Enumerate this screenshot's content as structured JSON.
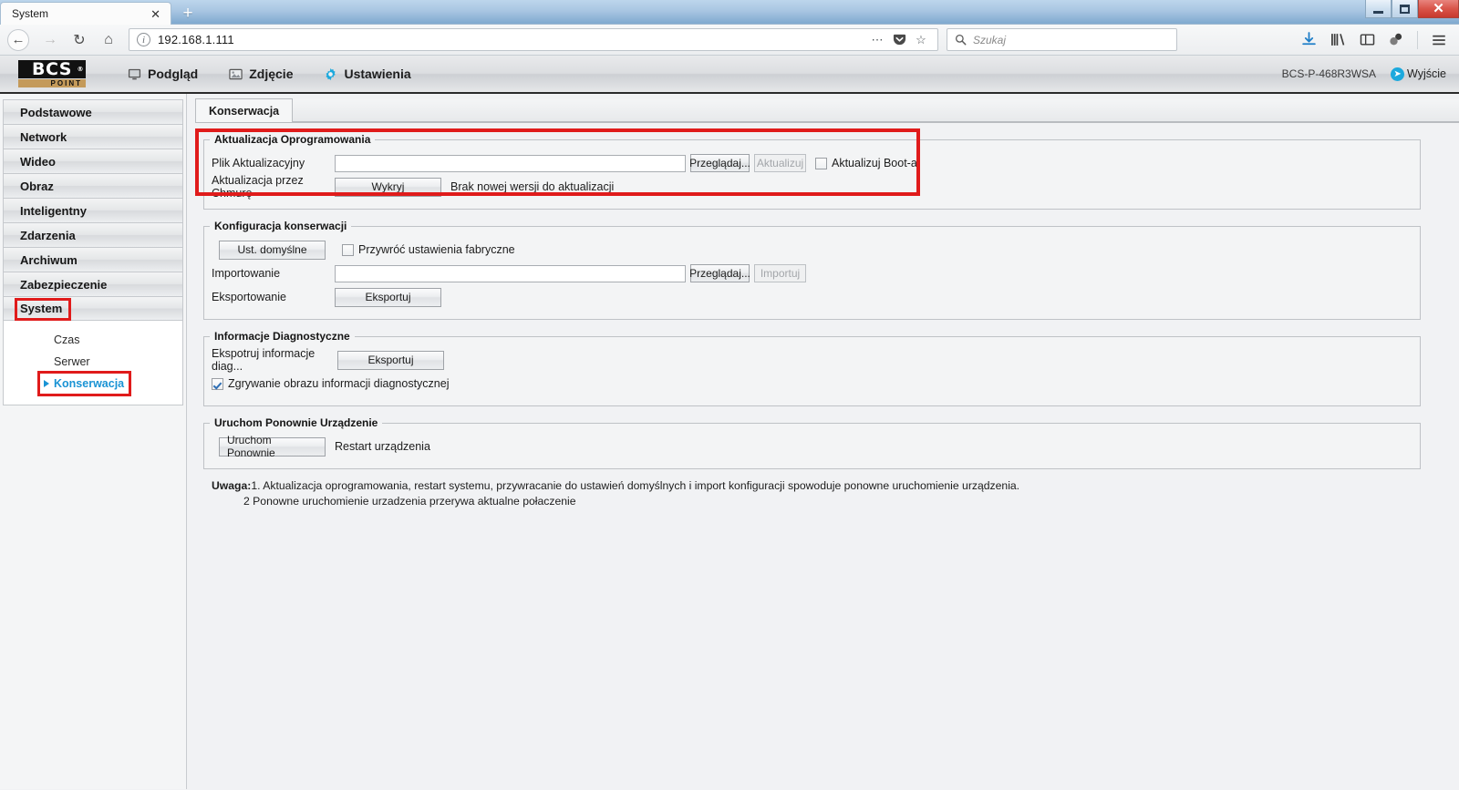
{
  "browser": {
    "tab_title": "System",
    "tab_close_label": "✕",
    "new_tab_label": "+",
    "url": "192.168.1.111",
    "search_placeholder": "Szukaj",
    "window_minimize": "minimize-icon",
    "window_maximize": "maximize-icon",
    "window_close": "✕"
  },
  "app_header": {
    "logo_main": "BCS",
    "logo_reg": "®",
    "logo_sub": "POINT",
    "menu": [
      {
        "label": "Podgląd",
        "icon": "monitor-icon",
        "active": false
      },
      {
        "label": "Zdjęcie",
        "icon": "picture-icon",
        "active": false
      },
      {
        "label": "Ustawienia",
        "icon": "gear-icon",
        "active": true
      }
    ],
    "device_name": "BCS-P-468R3WSA",
    "logout_label": "Wyjście"
  },
  "sidebar": {
    "items": [
      {
        "label": "Podstawowe",
        "highlighted": false
      },
      {
        "label": "Network",
        "highlighted": false
      },
      {
        "label": "Wideo",
        "highlighted": false
      },
      {
        "label": "Obraz",
        "highlighted": false
      },
      {
        "label": "Inteligentny",
        "highlighted": false
      },
      {
        "label": "Zdarzenia",
        "highlighted": false
      },
      {
        "label": "Archiwum",
        "highlighted": false
      },
      {
        "label": "Zabezpieczenie",
        "highlighted": false
      },
      {
        "label": "System",
        "highlighted": true
      }
    ],
    "sub_items": [
      {
        "label": "Czas",
        "active": false,
        "highlighted": false
      },
      {
        "label": "Serwer",
        "active": false,
        "highlighted": false
      },
      {
        "label": "Konserwacja",
        "active": true,
        "highlighted": true
      }
    ]
  },
  "main": {
    "tab_label": "Konserwacja",
    "firmware": {
      "legend": "Aktualizacja Oprogramowania",
      "file_label": "Plik Aktualizacyjny",
      "file_value": "",
      "browse_label": "Przeglądaj...",
      "update_label": "Aktualizuj",
      "boot_checkbox_label": "Aktualizuj Boot-a",
      "boot_checked": false,
      "cloud_label": "Aktualizacja przez Chmurę",
      "detect_label": "Wykryj",
      "cloud_status": "Brak nowej wersji do aktualizacji"
    },
    "config": {
      "legend": "Konfiguracja konserwacji",
      "defaults_button": "Ust. domyślne",
      "factory_checkbox_label": "Przywróć ustawienia fabryczne",
      "factory_checked": false,
      "import_label": "Importowanie",
      "import_value": "",
      "browse_label": "Przeglądaj...",
      "import_button": "Importuj",
      "export_label": "Eksportowanie",
      "export_button": "Eksportuj"
    },
    "diagnostics": {
      "legend": "Informacje Diagnostyczne",
      "export_label": "Ekspotruj informacje diag...",
      "export_button": "Eksportuj",
      "capture_checkbox_label": "Zgrywanie obrazu informacji diagnostycznej",
      "capture_checked": true
    },
    "reboot": {
      "legend": "Uruchom Ponownie Urządzenie",
      "reboot_button": "Uruchom Ponownie",
      "reboot_note": "Restart urządzenia"
    },
    "note": {
      "prefix": "Uwaga:",
      "line1": "1. Aktualizacja oprogramowania, restart systemu, przywracanie do ustawień domyślnych i import konfiguracji spowoduje ponowne uruchomienie urządzenia.",
      "line2": "2 Ponowne uruchomienie urzadzenia przerywa aktualne połaczenie"
    }
  },
  "colors": {
    "accent": "#1a93d4",
    "annotation": "#e01b1b",
    "logo_gold": "#c49a5a"
  }
}
